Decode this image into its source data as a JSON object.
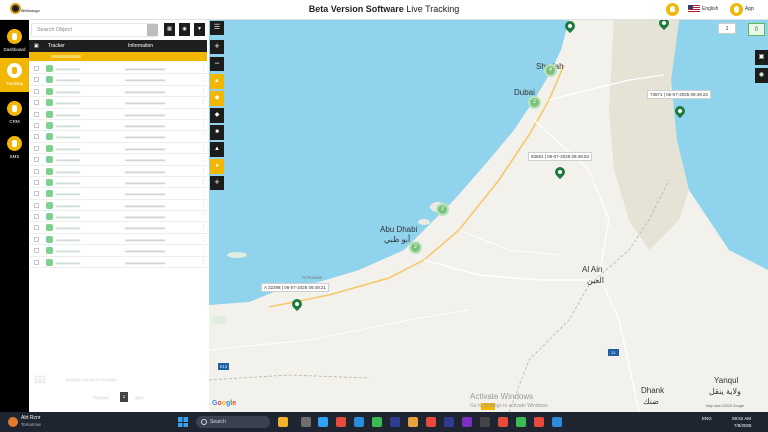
{
  "app": {
    "title_bold": "Beta Version Software",
    "title_rest": " Live Tracking",
    "logo_text": "Wellmango",
    "language": "English",
    "app_label": "App"
  },
  "leftnav": [
    {
      "label": "Dashboard",
      "icon": "dashboard-icon",
      "active": false
    },
    {
      "label": "Tracking",
      "icon": "location-pin-icon",
      "active": true
    },
    {
      "label": "CRM",
      "icon": "headset-icon",
      "active": false
    },
    {
      "label": "SMS",
      "icon": "chat-icon",
      "active": false
    }
  ],
  "panel": {
    "search_placeholder": "Search Object",
    "columns": {
      "tracker": "Tracker",
      "information": "Information"
    },
    "current_page": "1"
  },
  "map": {
    "select_value": "1",
    "count": "0",
    "cities": {
      "abu_dhabi": "Abu Dhabi",
      "abu_dhabi_ar": "أبو ظبي",
      "al_ain": "Al Ain",
      "al_ain_ar": "العين",
      "dubai": "Dubai",
      "sharjah": "Sharjah",
      "dhank": "Dhank",
      "dhank_ar": "ضنك",
      "yanqul": "Yanqul",
      "yanqul_ar": "ولاية ينقل",
      "al_ruwais": "Al Ruwais"
    },
    "labels": [
      {
        "text": "73871 | 06-07-2025 09:49:22"
      },
      {
        "text": "93581 | 06-07-2025 09:48:53"
      },
      {
        "text": "A 22298 | 06-07-2025 09:49:21"
      }
    ],
    "clusters": [
      "4",
      "2",
      "2",
      "2"
    ],
    "highway": "E11",
    "highway2": "E13",
    "highway3": "21",
    "attribution": "Map data ©2025 Google"
  },
  "taskbar": {
    "weather_title": "Alrt Rcnr",
    "weather_sub": "Tomorrow",
    "search": "Search",
    "lang": "ENG",
    "time": "09:52 AM",
    "date": "7/9/2025",
    "watermark": "Activate Windows",
    "watermark_sub": "Go to Settings to activate Windows."
  }
}
